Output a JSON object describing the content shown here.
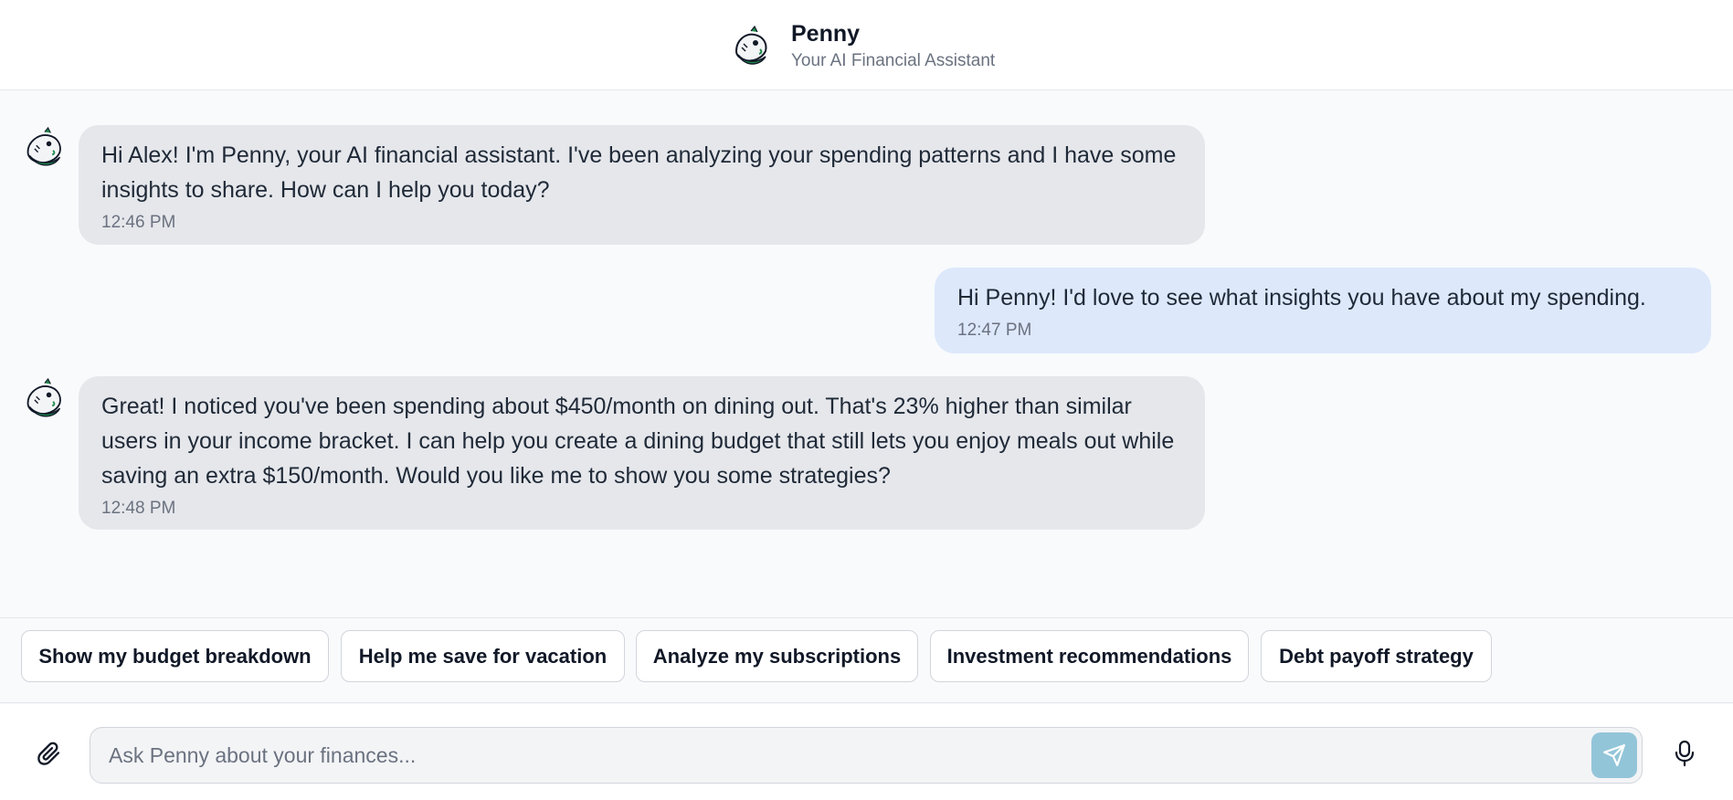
{
  "header": {
    "title": "Penny",
    "subtitle": "Your AI Financial Assistant",
    "avatar_icon": "fish-mascot-icon"
  },
  "messages": [
    {
      "sender": "bot",
      "text": "Hi Alex! I'm Penny, your AI financial assistant. I've been analyzing your spending patterns and I have some insights to share. How can I help you today?",
      "time": "12:46 PM"
    },
    {
      "sender": "user",
      "text": "Hi Penny! I'd love to see what insights you have about my spending.",
      "time": "12:47 PM"
    },
    {
      "sender": "bot",
      "text": "Great! I noticed you've been spending about $450/month on dining out. That's 23% higher than similar users in your income bracket. I can help you create a dining budget that still lets you enjoy meals out while saving an extra $150/month. Would you like me to show you some strategies?",
      "time": "12:48 PM"
    }
  ],
  "suggestions": [
    "Show my budget breakdown",
    "Help me save for vacation",
    "Analyze my subscriptions",
    "Investment recommendations",
    "Debt payoff strategy"
  ],
  "composer": {
    "placeholder": "Ask Penny about your finances...",
    "value": "",
    "attach_icon": "paperclip-icon",
    "send_icon": "send-icon",
    "mic_icon": "microphone-icon"
  },
  "colors": {
    "bot_bubble": "#e5e7eb",
    "user_bubble": "#dde8fb",
    "send_button": "#93c5d9",
    "mascot_green": "#1f8a4c"
  }
}
